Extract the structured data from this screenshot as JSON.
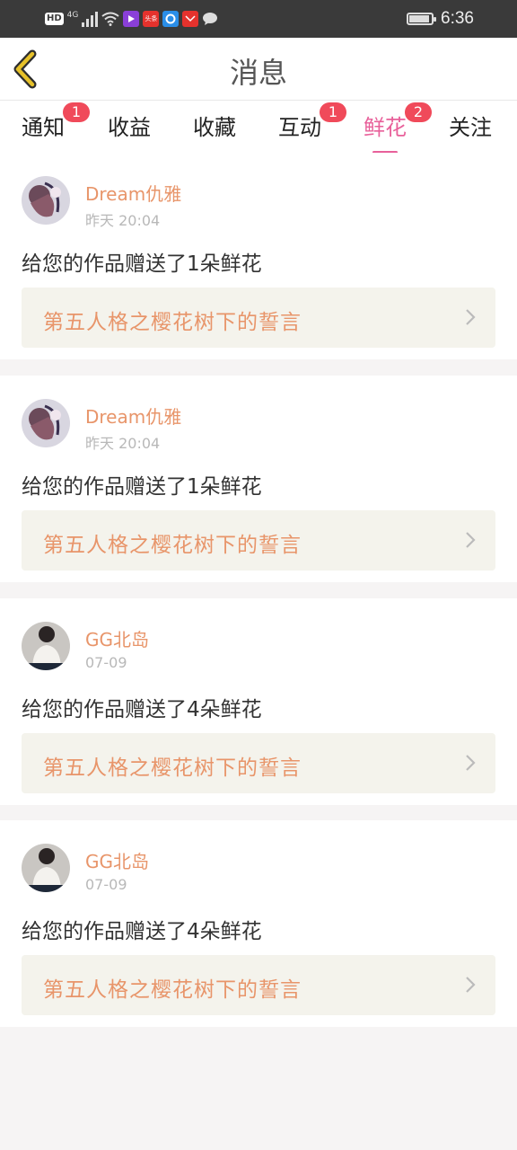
{
  "status_bar": {
    "network": "4G",
    "hd": "HD",
    "app_icons": [
      "video-app-icon",
      "toutiao-app-icon",
      "browser-app-icon",
      "huawei-app-icon",
      "message-app-icon"
    ],
    "app_toutiao_label": "头条",
    "battery_level": 0.9,
    "time": "6:36"
  },
  "header": {
    "title": "消息",
    "back_icon": "chevron-left-icon",
    "back_color": "#e6c12a"
  },
  "tabs": [
    {
      "label": "通知",
      "badge": "1",
      "active": false
    },
    {
      "label": "收益",
      "badge": "",
      "active": false
    },
    {
      "label": "收藏",
      "badge": "",
      "active": false
    },
    {
      "label": "互动",
      "badge": "1",
      "active": false
    },
    {
      "label": "鲜花",
      "badge": "2",
      "active": true
    },
    {
      "label": "关注",
      "badge": "",
      "active": false
    }
  ],
  "colors": {
    "accent": "#e8609a",
    "badge": "#f04a5a",
    "username": "#e8956a",
    "link_bg": "#f4f3ec"
  },
  "messages": [
    {
      "username": "Dream仇雅",
      "time": "昨天 20:04",
      "text": "给您的作品赠送了1朵鲜花",
      "work_title": "第五人格之樱花树下的誓言"
    },
    {
      "username": "Dream仇雅",
      "time": "昨天 20:04",
      "text": "给您的作品赠送了1朵鲜花",
      "work_title": "第五人格之樱花树下的誓言"
    },
    {
      "username": "GG北岛",
      "time": "07-09",
      "text": "给您的作品赠送了4朵鲜花",
      "work_title": "第五人格之樱花树下的誓言"
    },
    {
      "username": "GG北岛",
      "time": "07-09",
      "text": "给您的作品赠送了4朵鲜花",
      "work_title": "第五人格之樱花树下的誓言"
    }
  ]
}
